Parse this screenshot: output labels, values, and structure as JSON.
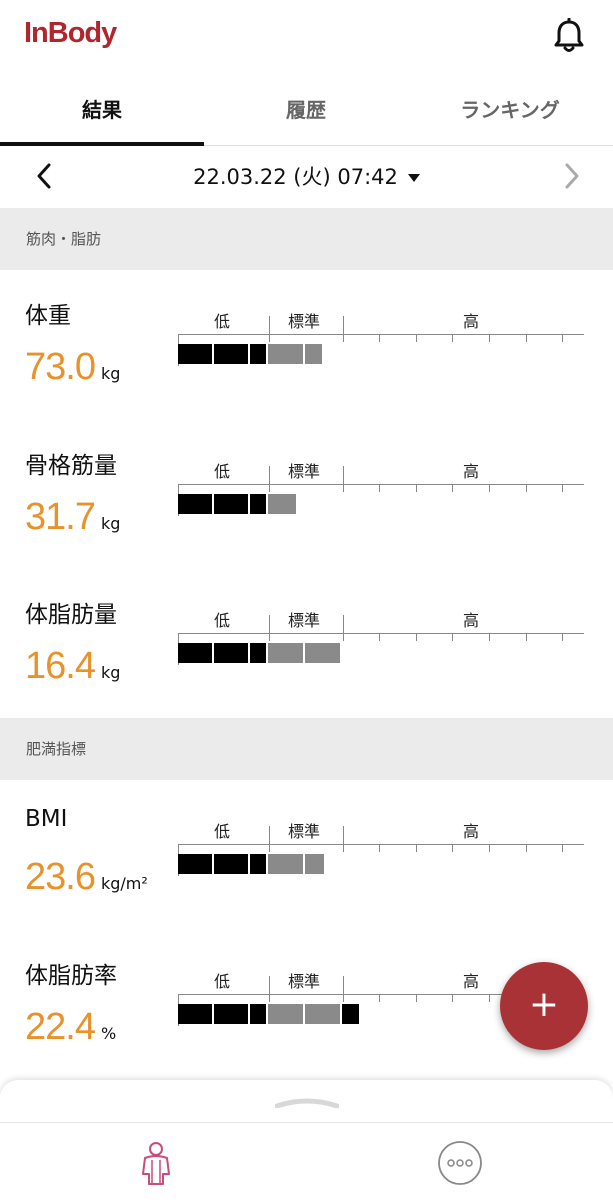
{
  "app": {
    "logo_text": "InBody",
    "brand_color": "#b0262c",
    "accent_color": "#e8922a"
  },
  "header": {
    "bell_icon": "bell-icon"
  },
  "tabs": [
    {
      "label": "結果",
      "active": true
    },
    {
      "label": "履歴",
      "active": false
    },
    {
      "label": "ランキング",
      "active": false
    }
  ],
  "date_nav": {
    "date_text": "22.03.22 (火) 07:42",
    "prev_icon": "chevron-left-icon",
    "next_icon": "chevron-right-icon",
    "dropdown_icon": "caret-down-icon"
  },
  "gauge_labels": {
    "low": "低",
    "standard": "標準",
    "high": "高"
  },
  "sections": [
    {
      "title": "筋肉・脂肪",
      "metrics": [
        {
          "name": "体重",
          "value": "73.0",
          "unit": "kg"
        },
        {
          "name": "骨格筋量",
          "value": "31.7",
          "unit": "kg"
        },
        {
          "name": "体脂肪量",
          "value": "16.4",
          "unit": "kg"
        }
      ]
    },
    {
      "title": "肥満指標",
      "metrics": [
        {
          "name": "BMI",
          "value": "23.6",
          "unit": "kg/m²"
        },
        {
          "name": "体脂肪率",
          "value": "22.4",
          "unit": "%"
        }
      ]
    }
  ],
  "fab": {
    "label": "+",
    "icon": "plus-icon"
  },
  "bottom_nav": {
    "left_icon": "body-figure-icon",
    "right_icon": "more-icon"
  }
}
